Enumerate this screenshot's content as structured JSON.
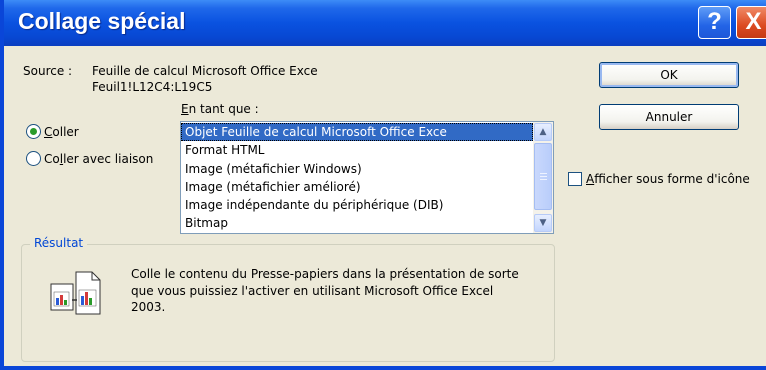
{
  "window": {
    "title": "Collage spécial",
    "help_glyph": "?",
    "close_glyph": "X"
  },
  "source": {
    "label": "Source :",
    "line1": "Feuille de calcul Microsoft Office Exce",
    "line2": "Feuil1!L12C4:L19C5"
  },
  "paste_as": {
    "label": "En tant que :",
    "items": [
      "Objet Feuille de calcul Microsoft Office Exce",
      "Format HTML",
      "Image (métafichier Windows)",
      "Image (métafichier amélioré)",
      "Image indépendante du périphérique (DIB)",
      "Bitmap"
    ],
    "selected_index": 0
  },
  "options": {
    "paste_label": "Coller",
    "paste_link_label": "Coller avec liaison",
    "paste_selected": true,
    "paste_link_selected": false
  },
  "buttons": {
    "ok_label": "OK",
    "cancel_label": "Annuler"
  },
  "display_as_icon": {
    "label": "Afficher sous forme d'icône",
    "checked": false
  },
  "result": {
    "legend": "Résultat",
    "text": "Colle le contenu du Presse-papiers dans la présentation de sorte que vous puissiez l'activer en utilisant Microsoft Office Excel 2003."
  },
  "icons": {
    "scroll_up": "scroll-up-arrow-icon",
    "scroll_down": "scroll-down-arrow-icon",
    "result": "excel-chart-documents-icon"
  },
  "colors": {
    "titlebar": "#0a52e0",
    "selection": "#316ac5",
    "legend": "#0046d5",
    "close": "#dc4a21"
  }
}
